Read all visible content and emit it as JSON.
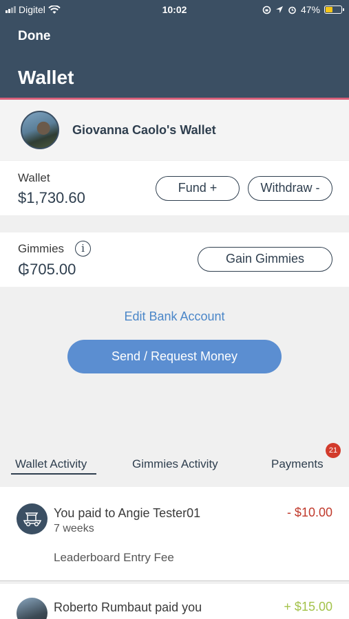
{
  "status": {
    "carrier": "Digitel",
    "time": "10:02",
    "battery_percent": "47%",
    "battery_level": 0.47
  },
  "header": {
    "done_label": "Done",
    "title": "Wallet"
  },
  "owner": {
    "name": "Giovanna Caolo's Wallet"
  },
  "wallet": {
    "label": "Wallet",
    "amount": "$1,730.60",
    "fund_label": "Fund +",
    "withdraw_label": "Withdraw -"
  },
  "gimmies": {
    "label": "Gimmies",
    "info_glyph": "i",
    "amount": "₲705.00",
    "gain_label": "Gain Gimmies"
  },
  "actions": {
    "edit_bank_label": "Edit Bank Account",
    "send_request_label": "Send / Request Money"
  },
  "tabs": {
    "items": [
      "Wallet Activity",
      "Gimmies Activity",
      "Payments"
    ],
    "active": "Wallet Activity",
    "payments_badge": "21"
  },
  "activity": [
    {
      "title": "You paid to Angie Tester01",
      "time": "7 weeks",
      "note": "Leaderboard Entry Fee",
      "amount": "- $10.00",
      "amount_color": "#c0392b",
      "icon": "golf-cart-icon"
    },
    {
      "title": "Roberto Rumbaut paid you",
      "amount": "+ $15.00",
      "amount_color": "#a3c24a",
      "icon": "user-avatar"
    }
  ],
  "colors": {
    "header_bg": "#3b4f63",
    "header_accent": "#d9607a",
    "primary_button": "#5b8ed1",
    "link": "#4a86c8",
    "badge": "#d23b2c"
  }
}
